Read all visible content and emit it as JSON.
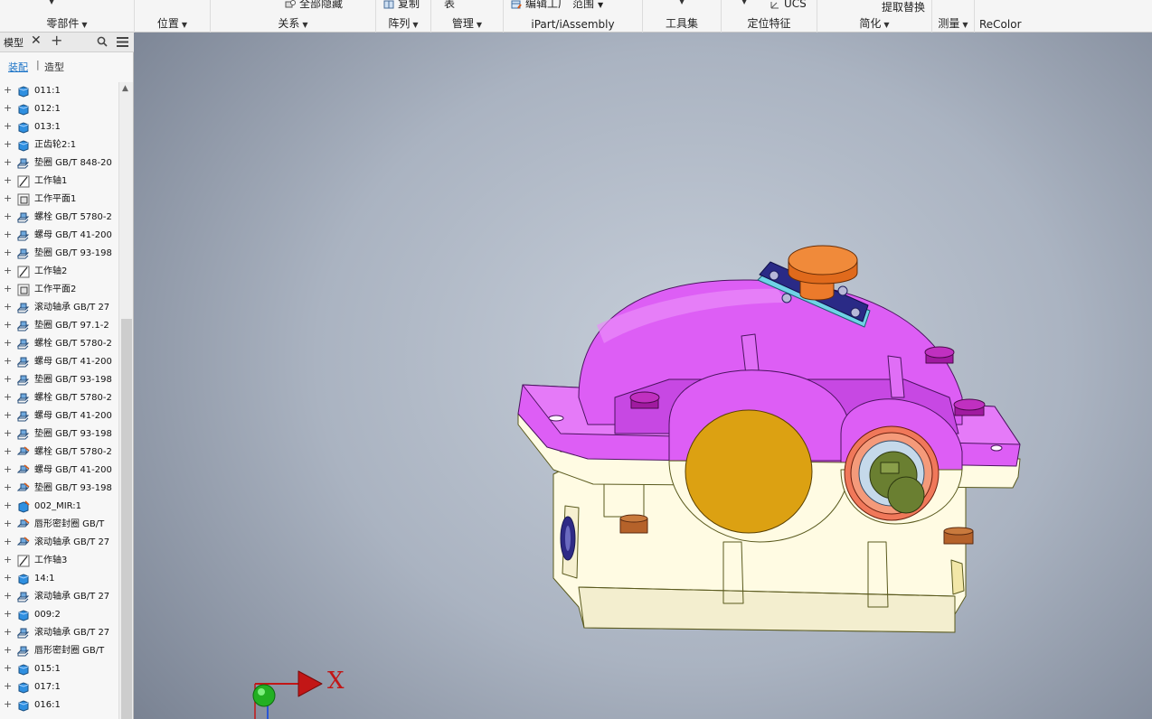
{
  "ribbon": {
    "groups": [
      {
        "label": "零部件"
      },
      {
        "label": "位置"
      },
      {
        "label": "关系"
      },
      {
        "label": "阵列"
      },
      {
        "label": "管理"
      },
      {
        "label": "iPart/iAssembly"
      },
      {
        "label": "工具集"
      },
      {
        "label": "定位特征"
      },
      {
        "label": "简化"
      },
      {
        "label": "测量"
      },
      {
        "label": "ReColor"
      }
    ],
    "cut_buttons": {
      "show_all": "全部隐藏",
      "copy": "复制",
      "table": "表",
      "edit": "编辑工厂",
      "range": "范围",
      "ucs": "UCS",
      "extract": "提取替换"
    }
  },
  "panel": {
    "tab_label": "模型",
    "mode_assembly": "装配",
    "mode_modeling": "造型",
    "tree": [
      {
        "label": "011:1",
        "icon": "part-icon"
      },
      {
        "label": "012:1",
        "icon": "part-icon"
      },
      {
        "label": "013:1",
        "icon": "part-icon"
      },
      {
        "label": "正齿轮2:1",
        "icon": "part-icon"
      },
      {
        "label": "垫圈 GB/T 848-20",
        "icon": "cc-part-icon"
      },
      {
        "label": "工作轴1",
        "icon": "work-axis-icon"
      },
      {
        "label": "工作平面1",
        "icon": "work-plane-icon"
      },
      {
        "label": "螺栓 GB/T 5780-2",
        "icon": "cc-part-icon"
      },
      {
        "label": "螺母 GB/T 41-200",
        "icon": "cc-part-icon"
      },
      {
        "label": "垫圈 GB/T 93-198",
        "icon": "cc-part-icon"
      },
      {
        "label": "工作轴2",
        "icon": "work-axis-icon"
      },
      {
        "label": "工作平面2",
        "icon": "work-plane-icon"
      },
      {
        "label": "滚动轴承 GB/T 27",
        "icon": "cc-part-icon"
      },
      {
        "label": "垫圈 GB/T 97.1-2",
        "icon": "cc-part-icon"
      },
      {
        "label": "螺栓 GB/T 5780-2",
        "icon": "cc-part-icon"
      },
      {
        "label": "螺母 GB/T 41-200",
        "icon": "cc-part-icon"
      },
      {
        "label": "垫圈 GB/T 93-198",
        "icon": "cc-part-icon"
      },
      {
        "label": "螺栓 GB/T 5780-2",
        "icon": "cc-part-icon"
      },
      {
        "label": "螺母 GB/T 41-200",
        "icon": "cc-part-icon"
      },
      {
        "label": "垫圈 GB/T 93-198",
        "icon": "cc-part-icon"
      },
      {
        "label": "螺栓 GB/T 5780-2",
        "icon": "cc-mirror-icon"
      },
      {
        "label": "螺母 GB/T 41-200",
        "icon": "cc-mirror-icon"
      },
      {
        "label": "垫圈 GB/T 93-198",
        "icon": "cc-mirror-icon"
      },
      {
        "label": "002_MIR:1",
        "icon": "mirror-part-icon"
      },
      {
        "label": "唇形密封圈 GB/T",
        "icon": "cc-mirror-icon"
      },
      {
        "label": "滚动轴承 GB/T 27",
        "icon": "cc-mirror-icon"
      },
      {
        "label": "工作轴3",
        "icon": "work-axis-icon"
      },
      {
        "label": "14:1",
        "icon": "part-icon"
      },
      {
        "label": "滚动轴承 GB/T 27",
        "icon": "cc-part-icon"
      },
      {
        "label": "009:2",
        "icon": "part-icon"
      },
      {
        "label": "滚动轴承 GB/T 27",
        "icon": "cc-part-icon"
      },
      {
        "label": "唇形密封圈 GB/T",
        "icon": "cc-part-icon"
      },
      {
        "label": "015:1",
        "icon": "part-icon"
      },
      {
        "label": "017:1",
        "icon": "part-icon"
      },
      {
        "label": "016:1",
        "icon": "part-icon"
      }
    ]
  },
  "viewport": {
    "triad_x_label": "X",
    "colors": {
      "cover": "#dd5ef5",
      "base": "#fffbe3",
      "outline": "#5a5a1e",
      "gear_disc": "#dca112",
      "shaft": "#6a7f31",
      "knob": "#ec7a2b",
      "plate": "#2a2a86",
      "bolt": "#a01aa0",
      "foot": "#b5622a"
    }
  }
}
